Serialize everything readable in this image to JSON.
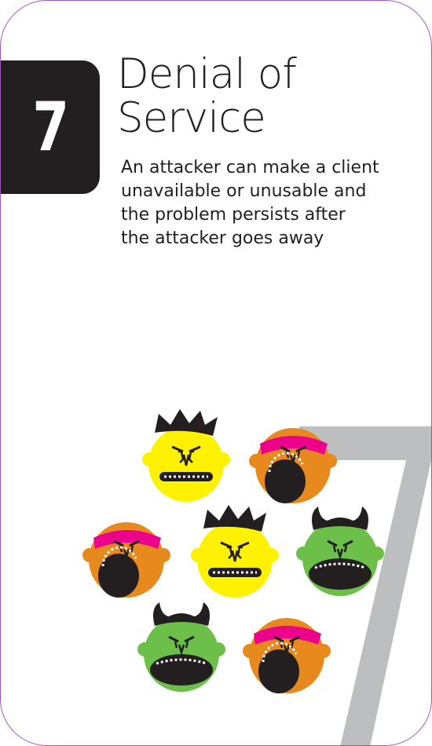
{
  "card": {
    "number": "7",
    "title_lines": [
      "Denial of",
      "Service"
    ],
    "description_lines": [
      "An attacker can make a client",
      "unavailable or unusable and",
      "the problem persists after",
      "the attacker goes away"
    ]
  },
  "colors": {
    "number_box": "#231f20",
    "border": "#9b59b6",
    "big_seven": "#bcbec0",
    "yellow_monster": "#fff200",
    "orange_monster": "#e8891e",
    "green_monster": "#6cc04a",
    "bandana": "#ec008c",
    "ink": "#231f20"
  },
  "illustration": {
    "monsters": [
      "yellow-crowned",
      "orange-bandana",
      "orange-bandana",
      "yellow-crowned",
      "green-horned",
      "green-horned",
      "orange-bandana"
    ]
  }
}
